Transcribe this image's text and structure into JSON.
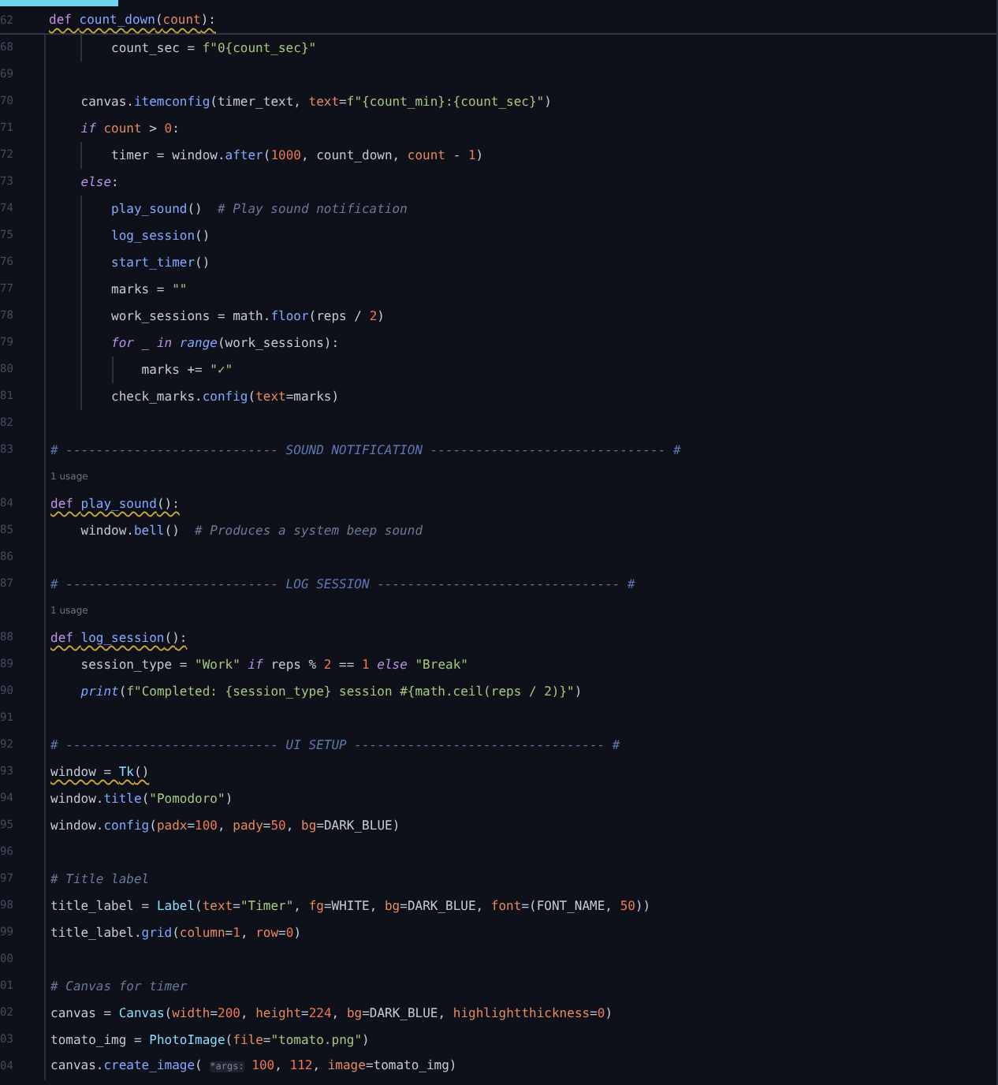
{
  "editor": {
    "lines": [
      {
        "kind": "code",
        "number": "62",
        "warning": true,
        "tokens": [
          {
            "kind": "kw",
            "text": "def "
          },
          {
            "kind": "fn",
            "text": "count_down"
          },
          {
            "kind": "plain",
            "text": "("
          },
          {
            "kind": "arg",
            "text": "count"
          },
          {
            "kind": "plain",
            "text": "):"
          }
        ]
      },
      {
        "kind": "code",
        "number": "68",
        "warning": false,
        "tokens": [
          {
            "kind": "plain",
            "text": "        count_sec = "
          },
          {
            "kind": "str",
            "text": "f\"0{count_sec}\""
          }
        ]
      },
      {
        "kind": "blank",
        "number": "69"
      },
      {
        "kind": "code",
        "number": "70",
        "warning": false,
        "tokens": [
          {
            "kind": "plain",
            "text": "    canvas."
          },
          {
            "kind": "fn",
            "text": "itemconfig"
          },
          {
            "kind": "plain",
            "text": "(timer_text, "
          },
          {
            "kind": "arg",
            "text": "text"
          },
          {
            "kind": "plain",
            "text": "="
          },
          {
            "kind": "str",
            "text": "f\"{count_min}:{count_sec}\""
          },
          {
            "kind": "plain",
            "text": ")"
          }
        ]
      },
      {
        "kind": "code",
        "number": "71",
        "warning": false,
        "tokens": [
          {
            "kind": "kwi",
            "text": "    if"
          },
          {
            "kind": "arg",
            "text": " count"
          },
          {
            "kind": "plain",
            "text": " > "
          },
          {
            "kind": "num",
            "text": "0"
          },
          {
            "kind": "plain",
            "text": ":"
          }
        ]
      },
      {
        "kind": "code",
        "number": "72",
        "warning": false,
        "tokens": [
          {
            "kind": "plain",
            "text": "        timer = window."
          },
          {
            "kind": "fn",
            "text": "after"
          },
          {
            "kind": "plain",
            "text": "("
          },
          {
            "kind": "num",
            "text": "1000"
          },
          {
            "kind": "plain",
            "text": ", count_down, "
          },
          {
            "kind": "arg",
            "text": "count"
          },
          {
            "kind": "plain",
            "text": " - "
          },
          {
            "kind": "num",
            "text": "1"
          },
          {
            "kind": "plain",
            "text": ")"
          }
        ]
      },
      {
        "kind": "code",
        "number": "73",
        "warning": false,
        "tokens": [
          {
            "kind": "kwi",
            "text": "    else"
          },
          {
            "kind": "plain",
            "text": ":"
          }
        ]
      },
      {
        "kind": "code",
        "number": "74",
        "warning": false,
        "tokens": [
          {
            "kind": "fn",
            "text": "        play_sound"
          },
          {
            "kind": "plain",
            "text": "()  "
          },
          {
            "kind": "cmt",
            "text": "# Play sound notification"
          }
        ]
      },
      {
        "kind": "code",
        "number": "75",
        "warning": false,
        "tokens": [
          {
            "kind": "fn",
            "text": "        log_session"
          },
          {
            "kind": "plain",
            "text": "()"
          }
        ]
      },
      {
        "kind": "code",
        "number": "76",
        "warning": false,
        "tokens": [
          {
            "kind": "fn",
            "text": "        start_timer"
          },
          {
            "kind": "plain",
            "text": "()"
          }
        ]
      },
      {
        "kind": "code",
        "number": "77",
        "warning": false,
        "tokens": [
          {
            "kind": "plain",
            "text": "        marks = "
          },
          {
            "kind": "str",
            "text": "\"\""
          }
        ]
      },
      {
        "kind": "code",
        "number": "78",
        "warning": false,
        "tokens": [
          {
            "kind": "plain",
            "text": "        work_sessions = math."
          },
          {
            "kind": "fn",
            "text": "floor"
          },
          {
            "kind": "plain",
            "text": "(reps / "
          },
          {
            "kind": "num",
            "text": "2"
          },
          {
            "kind": "plain",
            "text": ")"
          }
        ]
      },
      {
        "kind": "code",
        "number": "79",
        "warning": false,
        "tokens": [
          {
            "kind": "kwi",
            "text": "        for"
          },
          {
            "kind": "plain",
            "text": " _ "
          },
          {
            "kind": "kwi",
            "text": "in"
          },
          {
            "kind": "bi",
            "text": " range"
          },
          {
            "kind": "plain",
            "text": "(work_sessions):"
          }
        ]
      },
      {
        "kind": "code",
        "number": "80",
        "warning": false,
        "tokens": [
          {
            "kind": "plain",
            "text": "            marks += "
          },
          {
            "kind": "str",
            "text": "\"✓\""
          }
        ]
      },
      {
        "kind": "code",
        "number": "81",
        "warning": false,
        "tokens": [
          {
            "kind": "plain",
            "text": "        check_marks."
          },
          {
            "kind": "fn",
            "text": "config"
          },
          {
            "kind": "plain",
            "text": "("
          },
          {
            "kind": "arg",
            "text": "text"
          },
          {
            "kind": "plain",
            "text": "=marks)"
          }
        ]
      },
      {
        "kind": "blank",
        "number": "82"
      },
      {
        "kind": "code",
        "number": "83",
        "warning": false,
        "tokens": [
          {
            "kind": "hdr",
            "text": "# ---------------------------- SOUND NOTIFICATION ------------------------------- #"
          }
        ]
      },
      {
        "kind": "usage",
        "text": "1 usage"
      },
      {
        "kind": "code",
        "number": "84",
        "warning": true,
        "tokens": [
          {
            "kind": "kw",
            "text": "def "
          },
          {
            "kind": "fn",
            "text": "play_sound"
          },
          {
            "kind": "plain",
            "text": "():"
          }
        ]
      },
      {
        "kind": "code",
        "number": "85",
        "warning": false,
        "tokens": [
          {
            "kind": "plain",
            "text": "    window."
          },
          {
            "kind": "fn",
            "text": "bell"
          },
          {
            "kind": "plain",
            "text": "()  "
          },
          {
            "kind": "cmt",
            "text": "# Produces a system beep sound"
          }
        ]
      },
      {
        "kind": "blank",
        "number": "86"
      },
      {
        "kind": "code",
        "number": "87",
        "warning": false,
        "tokens": [
          {
            "kind": "hdr",
            "text": "# ---------------------------- LOG SESSION -------------------------------- #"
          }
        ]
      },
      {
        "kind": "usage",
        "text": "1 usage"
      },
      {
        "kind": "code",
        "number": "88",
        "warning": true,
        "tokens": [
          {
            "kind": "kw",
            "text": "def "
          },
          {
            "kind": "fn",
            "text": "log_session"
          },
          {
            "kind": "plain",
            "text": "():"
          }
        ]
      },
      {
        "kind": "code",
        "number": "89",
        "warning": false,
        "tokens": [
          {
            "kind": "plain",
            "text": "    session_type = "
          },
          {
            "kind": "str",
            "text": "\"Work\""
          },
          {
            "kind": "kwi",
            "text": " if"
          },
          {
            "kind": "plain",
            "text": " reps % "
          },
          {
            "kind": "num",
            "text": "2"
          },
          {
            "kind": "plain",
            "text": " == "
          },
          {
            "kind": "num",
            "text": "1"
          },
          {
            "kind": "kwi",
            "text": " else"
          },
          {
            "kind": "str",
            "text": " \"Break\""
          }
        ]
      },
      {
        "kind": "code",
        "number": "90",
        "warning": false,
        "tokens": [
          {
            "kind": "bi",
            "text": "    print"
          },
          {
            "kind": "plain",
            "text": "("
          },
          {
            "kind": "str",
            "text": "f\"Completed: {session_type} session #{math.ceil(reps / 2)}\""
          },
          {
            "kind": "plain",
            "text": ")"
          }
        ]
      },
      {
        "kind": "blank",
        "number": "91"
      },
      {
        "kind": "code",
        "number": "92",
        "warning": false,
        "tokens": [
          {
            "kind": "hdr",
            "text": "# ---------------------------- UI SETUP --------------------------------- #"
          }
        ]
      },
      {
        "kind": "code",
        "number": "93",
        "warning": true,
        "tokens": [
          {
            "kind": "plain",
            "text": "window = "
          },
          {
            "kind": "cls",
            "text": "Tk"
          },
          {
            "kind": "plain",
            "text": "()"
          }
        ]
      },
      {
        "kind": "code",
        "number": "94",
        "warning": false,
        "tokens": [
          {
            "kind": "plain",
            "text": "window."
          },
          {
            "kind": "fn",
            "text": "title"
          },
          {
            "kind": "plain",
            "text": "("
          },
          {
            "kind": "str",
            "text": "\"Pomodoro\""
          },
          {
            "kind": "plain",
            "text": ")"
          }
        ]
      },
      {
        "kind": "code",
        "number": "95",
        "warning": false,
        "tokens": [
          {
            "kind": "plain",
            "text": "window."
          },
          {
            "kind": "fn",
            "text": "config"
          },
          {
            "kind": "plain",
            "text": "("
          },
          {
            "kind": "arg",
            "text": "padx"
          },
          {
            "kind": "plain",
            "text": "="
          },
          {
            "kind": "num",
            "text": "100"
          },
          {
            "kind": "plain",
            "text": ", "
          },
          {
            "kind": "arg",
            "text": "pady"
          },
          {
            "kind": "plain",
            "text": "="
          },
          {
            "kind": "num",
            "text": "50"
          },
          {
            "kind": "plain",
            "text": ", "
          },
          {
            "kind": "arg",
            "text": "bg"
          },
          {
            "kind": "plain",
            "text": "=DARK_BLUE)"
          }
        ]
      },
      {
        "kind": "blank",
        "number": "96"
      },
      {
        "kind": "code",
        "number": "97",
        "warning": false,
        "tokens": [
          {
            "kind": "cmt",
            "text": "# Title label"
          }
        ]
      },
      {
        "kind": "code",
        "number": "98",
        "warning": false,
        "tokens": [
          {
            "kind": "plain",
            "text": "title_label = "
          },
          {
            "kind": "cls",
            "text": "Label"
          },
          {
            "kind": "plain",
            "text": "("
          },
          {
            "kind": "arg",
            "text": "text"
          },
          {
            "kind": "plain",
            "text": "="
          },
          {
            "kind": "str",
            "text": "\"Timer\""
          },
          {
            "kind": "plain",
            "text": ", "
          },
          {
            "kind": "arg",
            "text": "fg"
          },
          {
            "kind": "plain",
            "text": "=WHITE, "
          },
          {
            "kind": "arg",
            "text": "bg"
          },
          {
            "kind": "plain",
            "text": "=DARK_BLUE, "
          },
          {
            "kind": "arg",
            "text": "font"
          },
          {
            "kind": "plain",
            "text": "=(FONT_NAME, "
          },
          {
            "kind": "num",
            "text": "50"
          },
          {
            "kind": "plain",
            "text": "))"
          }
        ]
      },
      {
        "kind": "code",
        "number": "99",
        "warning": false,
        "tokens": [
          {
            "kind": "plain",
            "text": "title_label."
          },
          {
            "kind": "fn",
            "text": "grid"
          },
          {
            "kind": "plain",
            "text": "("
          },
          {
            "kind": "arg",
            "text": "column"
          },
          {
            "kind": "plain",
            "text": "="
          },
          {
            "kind": "num",
            "text": "1"
          },
          {
            "kind": "plain",
            "text": ", "
          },
          {
            "kind": "arg",
            "text": "row"
          },
          {
            "kind": "plain",
            "text": "="
          },
          {
            "kind": "num",
            "text": "0"
          },
          {
            "kind": "plain",
            "text": ")"
          }
        ]
      },
      {
        "kind": "blank",
        "number": "00"
      },
      {
        "kind": "code",
        "number": "01",
        "warning": false,
        "tokens": [
          {
            "kind": "cmt",
            "text": "# Canvas for timer"
          }
        ]
      },
      {
        "kind": "code",
        "number": "02",
        "warning": false,
        "tokens": [
          {
            "kind": "plain",
            "text": "canvas = "
          },
          {
            "kind": "cls",
            "text": "Canvas"
          },
          {
            "kind": "plain",
            "text": "("
          },
          {
            "kind": "arg",
            "text": "width"
          },
          {
            "kind": "plain",
            "text": "="
          },
          {
            "kind": "num",
            "text": "200"
          },
          {
            "kind": "plain",
            "text": ", "
          },
          {
            "kind": "arg",
            "text": "height"
          },
          {
            "kind": "plain",
            "text": "="
          },
          {
            "kind": "num",
            "text": "224"
          },
          {
            "kind": "plain",
            "text": ", "
          },
          {
            "kind": "arg",
            "text": "bg"
          },
          {
            "kind": "plain",
            "text": "=DARK_BLUE, "
          },
          {
            "kind": "arg",
            "text": "highlightthickness"
          },
          {
            "kind": "plain",
            "text": "="
          },
          {
            "kind": "num",
            "text": "0"
          },
          {
            "kind": "plain",
            "text": ")"
          }
        ]
      },
      {
        "kind": "code",
        "number": "03",
        "warning": false,
        "tokens": [
          {
            "kind": "plain",
            "text": "tomato_img = "
          },
          {
            "kind": "cls",
            "text": "PhotoImage"
          },
          {
            "kind": "plain",
            "text": "("
          },
          {
            "kind": "arg",
            "text": "file"
          },
          {
            "kind": "plain",
            "text": "="
          },
          {
            "kind": "str",
            "text": "\"tomato.png\""
          },
          {
            "kind": "plain",
            "text": ")"
          }
        ]
      },
      {
        "kind": "code",
        "number": "04",
        "warning": false,
        "tokens": [
          {
            "kind": "plain",
            "text": "canvas."
          },
          {
            "kind": "fn",
            "text": "create_image"
          },
          {
            "kind": "plain",
            "text": "( "
          },
          {
            "kind": "hint",
            "text": "*args:"
          },
          {
            "kind": "num",
            "text": " 100"
          },
          {
            "kind": "plain",
            "text": ", "
          },
          {
            "kind": "num",
            "text": "112"
          },
          {
            "kind": "plain",
            "text": ", "
          },
          {
            "kind": "arg",
            "text": "image"
          },
          {
            "kind": "plain",
            "text": "=tomato_img)"
          }
        ]
      }
    ]
  }
}
